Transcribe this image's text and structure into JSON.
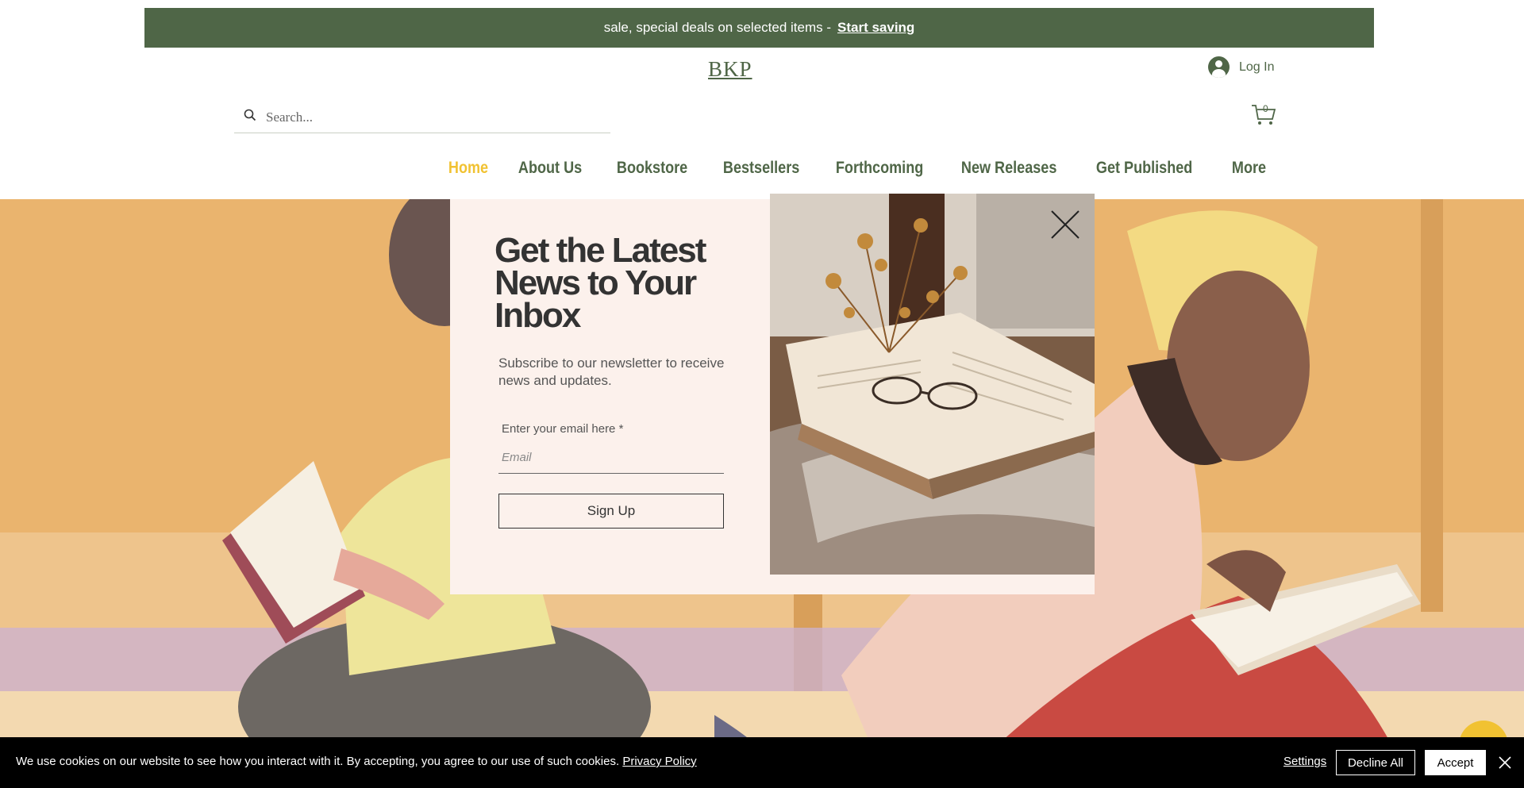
{
  "promo_banner": {
    "text": "sale, special deals on selected items -",
    "link": "Start saving"
  },
  "header": {
    "logo": "BKP",
    "login_label": "Log In",
    "search_placeholder": "Search...",
    "cart_count": "0"
  },
  "nav": {
    "items": [
      {
        "label": "Home",
        "active": true
      },
      {
        "label": "About Us"
      },
      {
        "label": "Bookstore"
      },
      {
        "label": "Bestsellers"
      },
      {
        "label": "Forthcoming"
      },
      {
        "label": "New Releases"
      },
      {
        "label": "Get Published"
      },
      {
        "label": "More"
      }
    ]
  },
  "popup": {
    "headline": "Get the Latest News to Your Inbox",
    "subtitle": "Subscribe to our newsletter to receive news and updates.",
    "email_label": "Enter your email here *",
    "email_placeholder": "Email",
    "signup_label": "Sign Up"
  },
  "cookie_bar": {
    "message": "We use cookies on our website to see how you interact with it. By accepting, you agree to our use of such cookies.",
    "policy_link": "Privacy Policy",
    "settings_label": "Settings",
    "decline_label": "Decline All",
    "accept_label": "Accept"
  },
  "colors": {
    "brand_green": "#4f6647",
    "accent_yellow": "#f1c232",
    "popup_bg": "#fcf1ec"
  },
  "icons": [
    "search-icon",
    "avatar-icon",
    "cart-icon",
    "close-icon",
    "chat-icon"
  ]
}
